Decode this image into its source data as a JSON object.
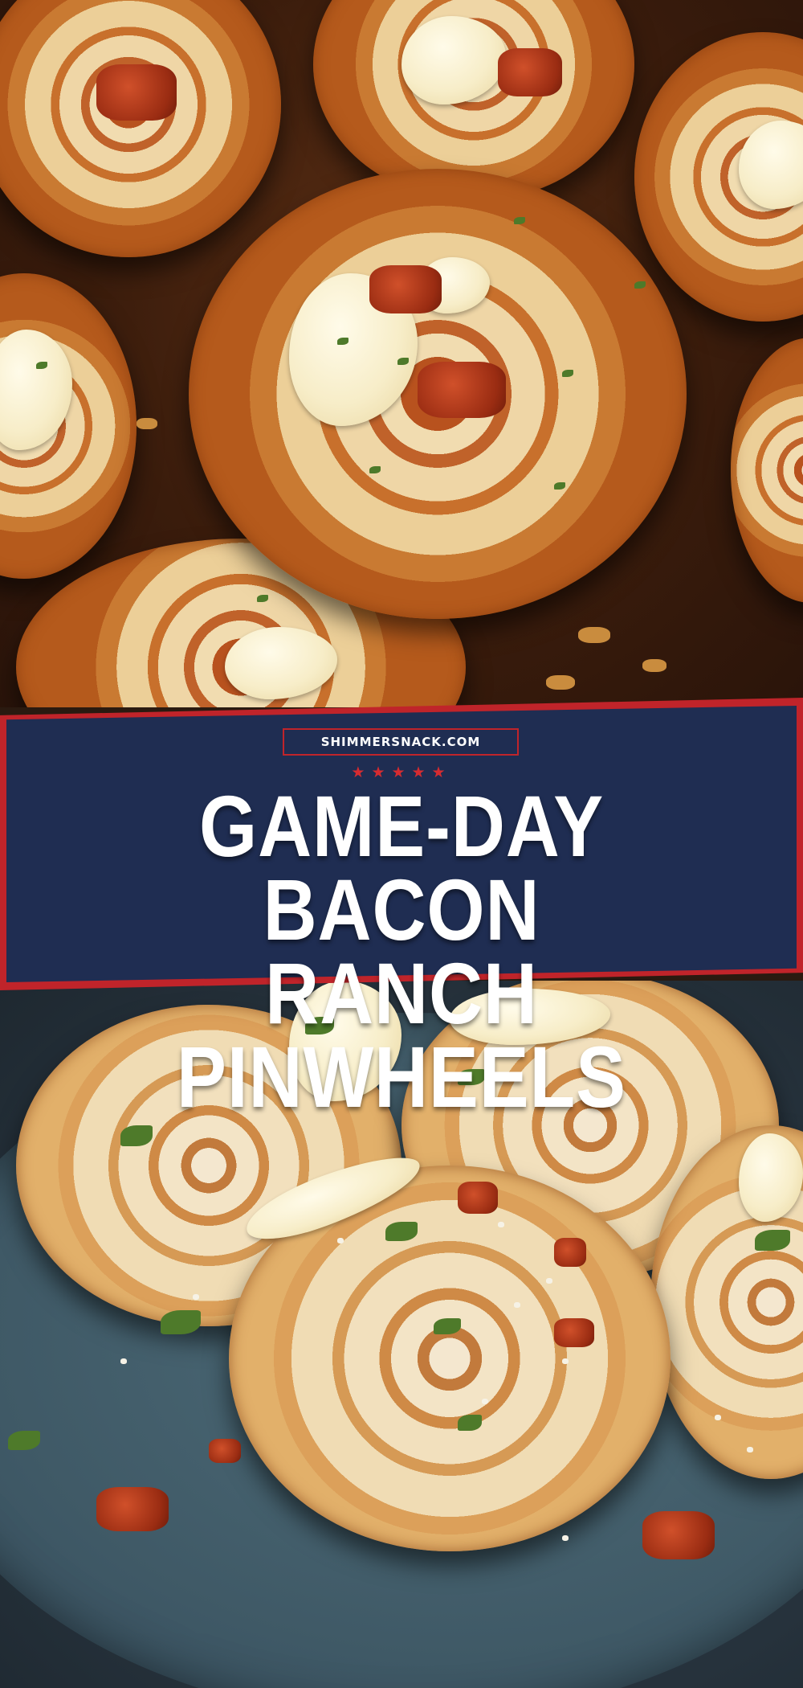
{
  "banner": {
    "site": "SHIMMERSNACK.COM",
    "stars": "★★★★★",
    "title_line1": "GAME-DAY BACON",
    "title_line2": "RANCH PINWHEELS"
  },
  "colors": {
    "banner_navy": "#1f2d52",
    "banner_red": "#c0242a",
    "title_text": "#ffffff"
  },
  "images": {
    "top": "close-up of baked golden pinwheels with bacon and ranch on a baking tray",
    "bottom": "pinwheels topped with ranch drizzle, crumbled cheese and herbs on a blue plate"
  }
}
